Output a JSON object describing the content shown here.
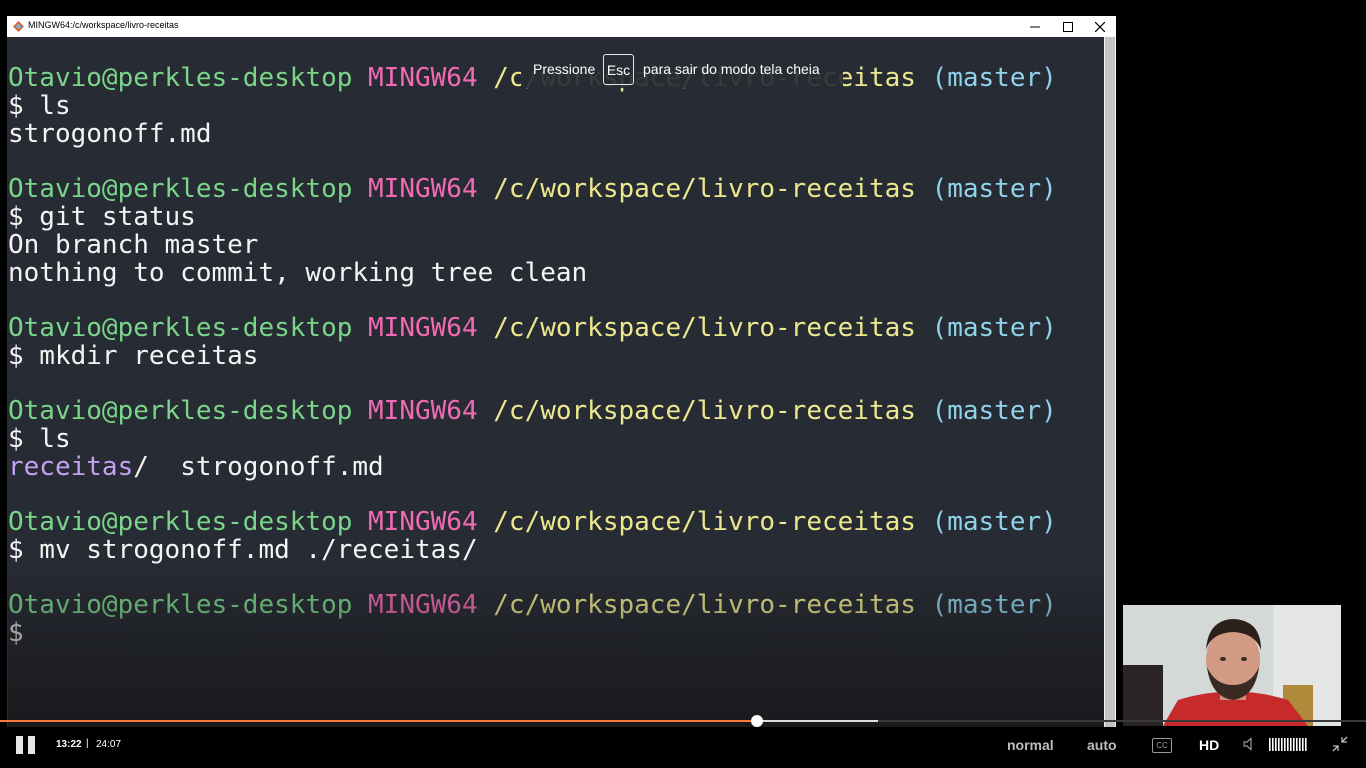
{
  "window": {
    "title": "MINGW64:/c/workspace/livro-receitas"
  },
  "terminal": {
    "lines": [
      {
        "type": "prompt",
        "user": "Otavio@perkles-desktop",
        "mingw": "MINGW64",
        "path": "/c/workspace/livro-receitas",
        "branch": "(master)"
      },
      {
        "type": "cmd",
        "text": "$ ls"
      },
      {
        "type": "out",
        "text": "strogonoff.md"
      },
      {
        "type": "prompt",
        "user": "Otavio@perkles-desktop",
        "mingw": "MINGW64",
        "path": "/c/workspace/livro-receitas",
        "branch": "(master)"
      },
      {
        "type": "cmd",
        "text": "$ git status"
      },
      {
        "type": "out",
        "text": "On branch master"
      },
      {
        "type": "out",
        "text": "nothing to commit, working tree clean"
      },
      {
        "type": "prompt",
        "user": "Otavio@perkles-desktop",
        "mingw": "MINGW64",
        "path": "/c/workspace/livro-receitas",
        "branch": "(master)"
      },
      {
        "type": "cmd",
        "text": "$ mkdir receitas"
      },
      {
        "type": "prompt",
        "user": "Otavio@perkles-desktop",
        "mingw": "MINGW64",
        "path": "/c/workspace/livro-receitas",
        "branch": "(master)"
      },
      {
        "type": "cmd",
        "text": "$ ls"
      },
      {
        "type": "ls",
        "dir": "receitas",
        "rest": "/  strogonoff.md"
      },
      {
        "type": "prompt",
        "user": "Otavio@perkles-desktop",
        "mingw": "MINGW64",
        "path": "/c/workspace/livro-receitas",
        "branch": "(master)"
      },
      {
        "type": "cmd",
        "text": "$ mv strogonoff.md ./receitas/"
      },
      {
        "type": "prompt",
        "user": "Otavio@perkles-desktop",
        "mingw": "MINGW64",
        "path": "/c/workspace/livro-receitas",
        "branch": "(master)"
      },
      {
        "type": "cmd",
        "text": "$"
      }
    ]
  },
  "fullscreen_notice": {
    "before": "Pressione",
    "key": "Esc",
    "after": "para sair do modo tela cheia"
  },
  "player": {
    "current_time": "13:22",
    "separator": "|",
    "total_time": "24:07",
    "progress_fraction": 0.5542,
    "buffered_fraction": 0.6428,
    "speed_label": "normal",
    "quality_label": "auto",
    "cc_label": "CC",
    "hd_label": "HD",
    "volume_level": 1.0,
    "accent_color": "#ff7a3d"
  },
  "icons": [
    "terminal-app-icon",
    "minimize-icon",
    "maximize-icon",
    "close-icon",
    "pause-icon",
    "captions-icon",
    "volume-icon",
    "exit-fullscreen-icon"
  ]
}
